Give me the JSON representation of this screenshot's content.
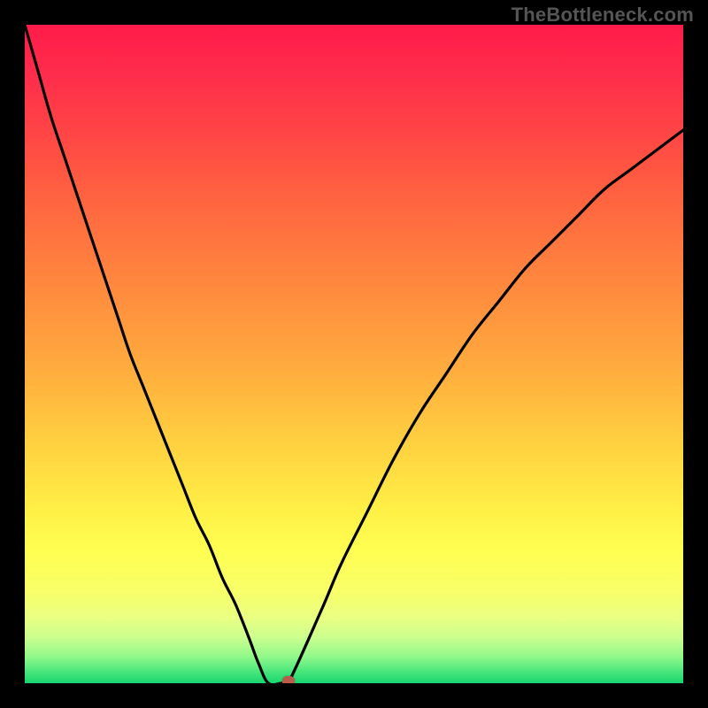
{
  "watermark": "TheBottleneck.com",
  "chart_data": {
    "type": "line",
    "title": "",
    "xlabel": "",
    "ylabel": "",
    "xlim": [
      0,
      100
    ],
    "ylim": [
      0,
      100
    ],
    "series": [
      {
        "name": "curve",
        "x": [
          0,
          2,
          4,
          6,
          8,
          10,
          12,
          14,
          16,
          18,
          20,
          22,
          24,
          26,
          28,
          30,
          32,
          34,
          35.5,
          37,
          39,
          40,
          45,
          48,
          52,
          56,
          60,
          64,
          68,
          72,
          76,
          80,
          84,
          88,
          92,
          96,
          100
        ],
        "y": [
          100,
          93,
          86,
          80,
          74,
          68,
          62,
          56,
          50,
          45,
          40,
          35,
          30,
          25,
          21,
          16,
          12,
          7,
          3,
          0,
          0,
          0,
          11,
          18,
          26,
          34,
          41,
          47,
          53,
          58,
          63,
          67,
          71,
          75,
          78,
          81,
          84
        ]
      }
    ],
    "marker": {
      "x": 40,
      "y": 0
    },
    "gradient_stops": [
      {
        "offset": 0.0,
        "color": "#ff1b4a"
      },
      {
        "offset": 0.08,
        "color": "#ff2e4b"
      },
      {
        "offset": 0.18,
        "color": "#ff4a44"
      },
      {
        "offset": 0.28,
        "color": "#ff6840"
      },
      {
        "offset": 0.4,
        "color": "#ff8a3e"
      },
      {
        "offset": 0.52,
        "color": "#ffab3e"
      },
      {
        "offset": 0.64,
        "color": "#ffd240"
      },
      {
        "offset": 0.74,
        "color": "#fff046"
      },
      {
        "offset": 0.8,
        "color": "#ffff52"
      },
      {
        "offset": 0.86,
        "color": "#f8ff68"
      },
      {
        "offset": 0.9,
        "color": "#eaff82"
      },
      {
        "offset": 0.93,
        "color": "#ccff8e"
      },
      {
        "offset": 0.96,
        "color": "#90f88a"
      },
      {
        "offset": 0.985,
        "color": "#40e47a"
      },
      {
        "offset": 1.0,
        "color": "#18d66e"
      }
    ]
  }
}
